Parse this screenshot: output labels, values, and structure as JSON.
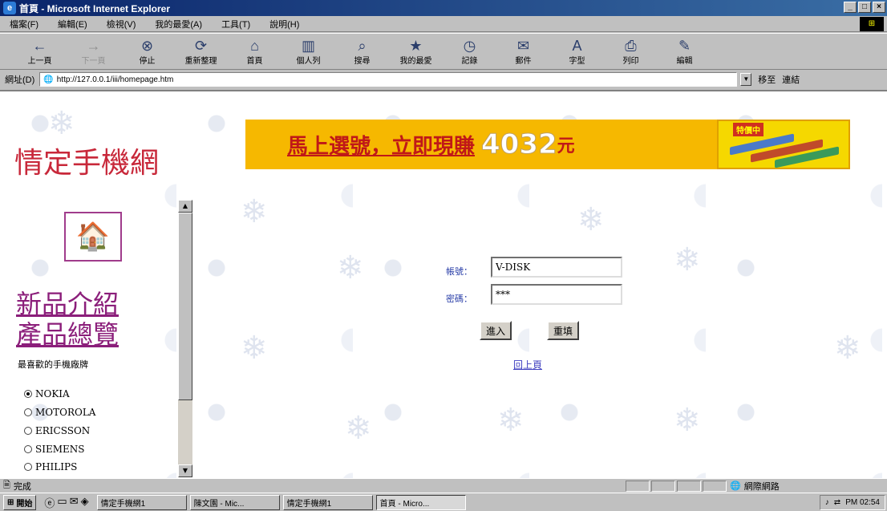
{
  "window": {
    "title": "首頁 - Microsoft Internet Explorer",
    "controls": [
      "_",
      "□",
      "×"
    ]
  },
  "menu": [
    "檔案(F)",
    "編輯(E)",
    "檢視(V)",
    "我的最愛(A)",
    "工具(T)",
    "說明(H)"
  ],
  "toolbar": [
    {
      "label": "上一頁",
      "icon": "back-arrow-icon",
      "glyph": "←"
    },
    {
      "label": "下一頁",
      "icon": "forward-arrow-icon",
      "glyph": "→",
      "disabled": true
    },
    {
      "label": "停止",
      "icon": "stop-icon",
      "glyph": "⊗"
    },
    {
      "label": "重新整理",
      "icon": "refresh-icon",
      "glyph": "⟳"
    },
    {
      "label": "首頁",
      "icon": "home-icon",
      "glyph": "⌂"
    },
    {
      "label": "個人列",
      "icon": "personal-bar-icon",
      "glyph": "▥"
    },
    {
      "label": "搜尋",
      "icon": "search-icon",
      "glyph": "⌕"
    },
    {
      "label": "我的最愛",
      "icon": "favorites-icon",
      "glyph": "★"
    },
    {
      "label": "記錄",
      "icon": "history-icon",
      "glyph": "◷"
    },
    {
      "label": "郵件",
      "icon": "mail-icon",
      "glyph": "✉"
    },
    {
      "label": "字型",
      "icon": "font-icon",
      "glyph": "A"
    },
    {
      "label": "列印",
      "icon": "print-icon",
      "glyph": "⎙"
    },
    {
      "label": "編輯",
      "icon": "edit-icon",
      "glyph": "✎"
    }
  ],
  "address": {
    "label": "網址(D)",
    "url": "http://127.0.0.1/iii/homepage.htm",
    "go_label": "移至",
    "links_label": "連結"
  },
  "page": {
    "site_title": "情定手機網",
    "banner": {
      "text_red": "馬上選號，立即現賺",
      "amount": "4032",
      "unit": "元"
    },
    "side_ad_tag": "特價中",
    "nav_links": [
      "新品介紹",
      "產品總覽"
    ],
    "brand_heading": "最喜歡的手機廠牌",
    "brands": [
      {
        "name": "NOKIA",
        "selected": true
      },
      {
        "name": "MOTOROLA",
        "selected": false
      },
      {
        "name": "ERICSSON",
        "selected": false
      },
      {
        "name": "SIEMENS",
        "selected": false
      },
      {
        "name": "PHILIPS",
        "selected": false
      }
    ],
    "login": {
      "account_label": "帳號：",
      "account_value": "V-DISK",
      "password_label": "密碼：",
      "password_value": "***",
      "submit_label": "進入",
      "reset_label": "重填",
      "back_link": "回上頁"
    }
  },
  "status": {
    "text": "完成",
    "zone": "網際網路"
  },
  "taskbar": {
    "start_label": "開始",
    "tasks": [
      "情定手機網1",
      "陳文園 - Mic...",
      "情定手機網1",
      "首頁 - Micro..."
    ],
    "clock": "PM 02:54"
  },
  "colors": {
    "title_red": "#c8283a",
    "link_purple": "#8b1e7a",
    "banner_bg": "#f6b800",
    "label_blue": "#2a3fa8"
  }
}
